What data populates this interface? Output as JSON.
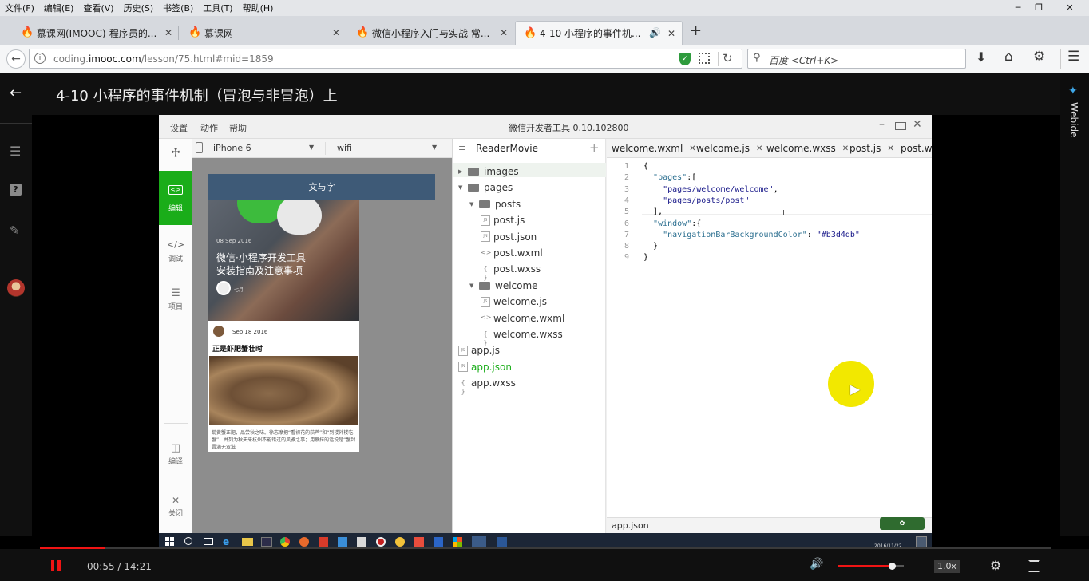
{
  "browser": {
    "menu": [
      "文件(F)",
      "编辑(E)",
      "查看(V)",
      "历史(S)",
      "书签(B)",
      "工具(T)",
      "帮助(H)"
    ],
    "tabs": [
      {
        "title": "慕课网(IMOOC)-程序员的...",
        "active": false
      },
      {
        "title": "慕课网",
        "active": false
      },
      {
        "title": "微信小程序入门与实战 常...",
        "active": false
      },
      {
        "title": "4-10 小程序的事件机...",
        "active": true
      }
    ],
    "url_prefix": "coding.",
    "url_domain": "imooc.com",
    "url_path": "/lesson/75.html#mid=1859",
    "search_placeholder": "百度 <Ctrl+K>"
  },
  "lesson": {
    "title": "4-10 小程序的事件机制（冒泡与非冒泡）上",
    "side_tab": "Webide"
  },
  "ide": {
    "menu": [
      "设置",
      "动作",
      "帮助"
    ],
    "title": "微信开发者工具 0.10.102800",
    "device": "iPhone 6",
    "network": "wifi",
    "nav": [
      {
        "label": "编辑",
        "active": true
      },
      {
        "label": "调试",
        "active": false
      },
      {
        "label": "项目",
        "active": false
      },
      {
        "label": "编译",
        "active": false
      },
      {
        "label": "关闭",
        "active": false
      }
    ],
    "project": "ReaderMovie",
    "tree": [
      {
        "name": "images",
        "kind": "folder",
        "level": 0
      },
      {
        "name": "pages",
        "kind": "folder",
        "level": 0
      },
      {
        "name": "posts",
        "kind": "folder",
        "level": 1
      },
      {
        "name": "post.js",
        "kind": "js",
        "level": 2
      },
      {
        "name": "post.json",
        "kind": "json",
        "level": 2
      },
      {
        "name": "post.wxml",
        "kind": "xml",
        "level": 2
      },
      {
        "name": "post.wxss",
        "kind": "css",
        "level": 2
      },
      {
        "name": "welcome",
        "kind": "folder",
        "level": 1
      },
      {
        "name": "welcome.js",
        "kind": "js",
        "level": 2
      },
      {
        "name": "welcome.wxml",
        "kind": "xml",
        "level": 2
      },
      {
        "name": "welcome.wxss",
        "kind": "css",
        "level": 2
      },
      {
        "name": "app.js",
        "kind": "js",
        "level": 0
      },
      {
        "name": "app.json",
        "kind": "json",
        "level": 0,
        "highlight": true
      },
      {
        "name": "app.wxss",
        "kind": "css",
        "level": 0
      }
    ],
    "editor_tabs": [
      "welcome.wxml",
      "welcome.js",
      "welcome.wxss",
      "post.js",
      "post.wx"
    ],
    "code_lines": [
      "{",
      "  \"pages\":[",
      "    \"pages/welcome/welcome\",",
      "    \"pages/posts/post\"",
      "  ],",
      "  \"window\":{",
      "    \"navigationBarBackgroundColor\": \"#b3d4db\"",
      "  }",
      "}"
    ],
    "status_file": "app.json",
    "phone": {
      "nav_title": "文与字",
      "post1_date": "08 Sep 2016",
      "post1_title_l1": "微信·小程序开发工具",
      "post1_title_l2": "安装指南及注意事项",
      "post1_author": "七月",
      "post2_date": "Sep 18 2016",
      "post2_title": "正是虾肥蟹壮时",
      "post2_text": "菊黄蟹正肥，品尝秋之味。徐志摩把“看初花的荻芦”和“到楼外楼吃蟹”，并列为秋天来杭州不能错过的风雅之事；用蔡抹的话说是“蟹封膏满无双滋"
    },
    "taskbar_date": "2016/11/22"
  },
  "player": {
    "time": "00:55 / 14:21",
    "speed": "1.0x",
    "progress": 0.064,
    "volume": 0.82
  },
  "colors": {
    "accent": "#f01414",
    "ide_green": "#1aad19",
    "phone_nav": "#3e5a77"
  }
}
